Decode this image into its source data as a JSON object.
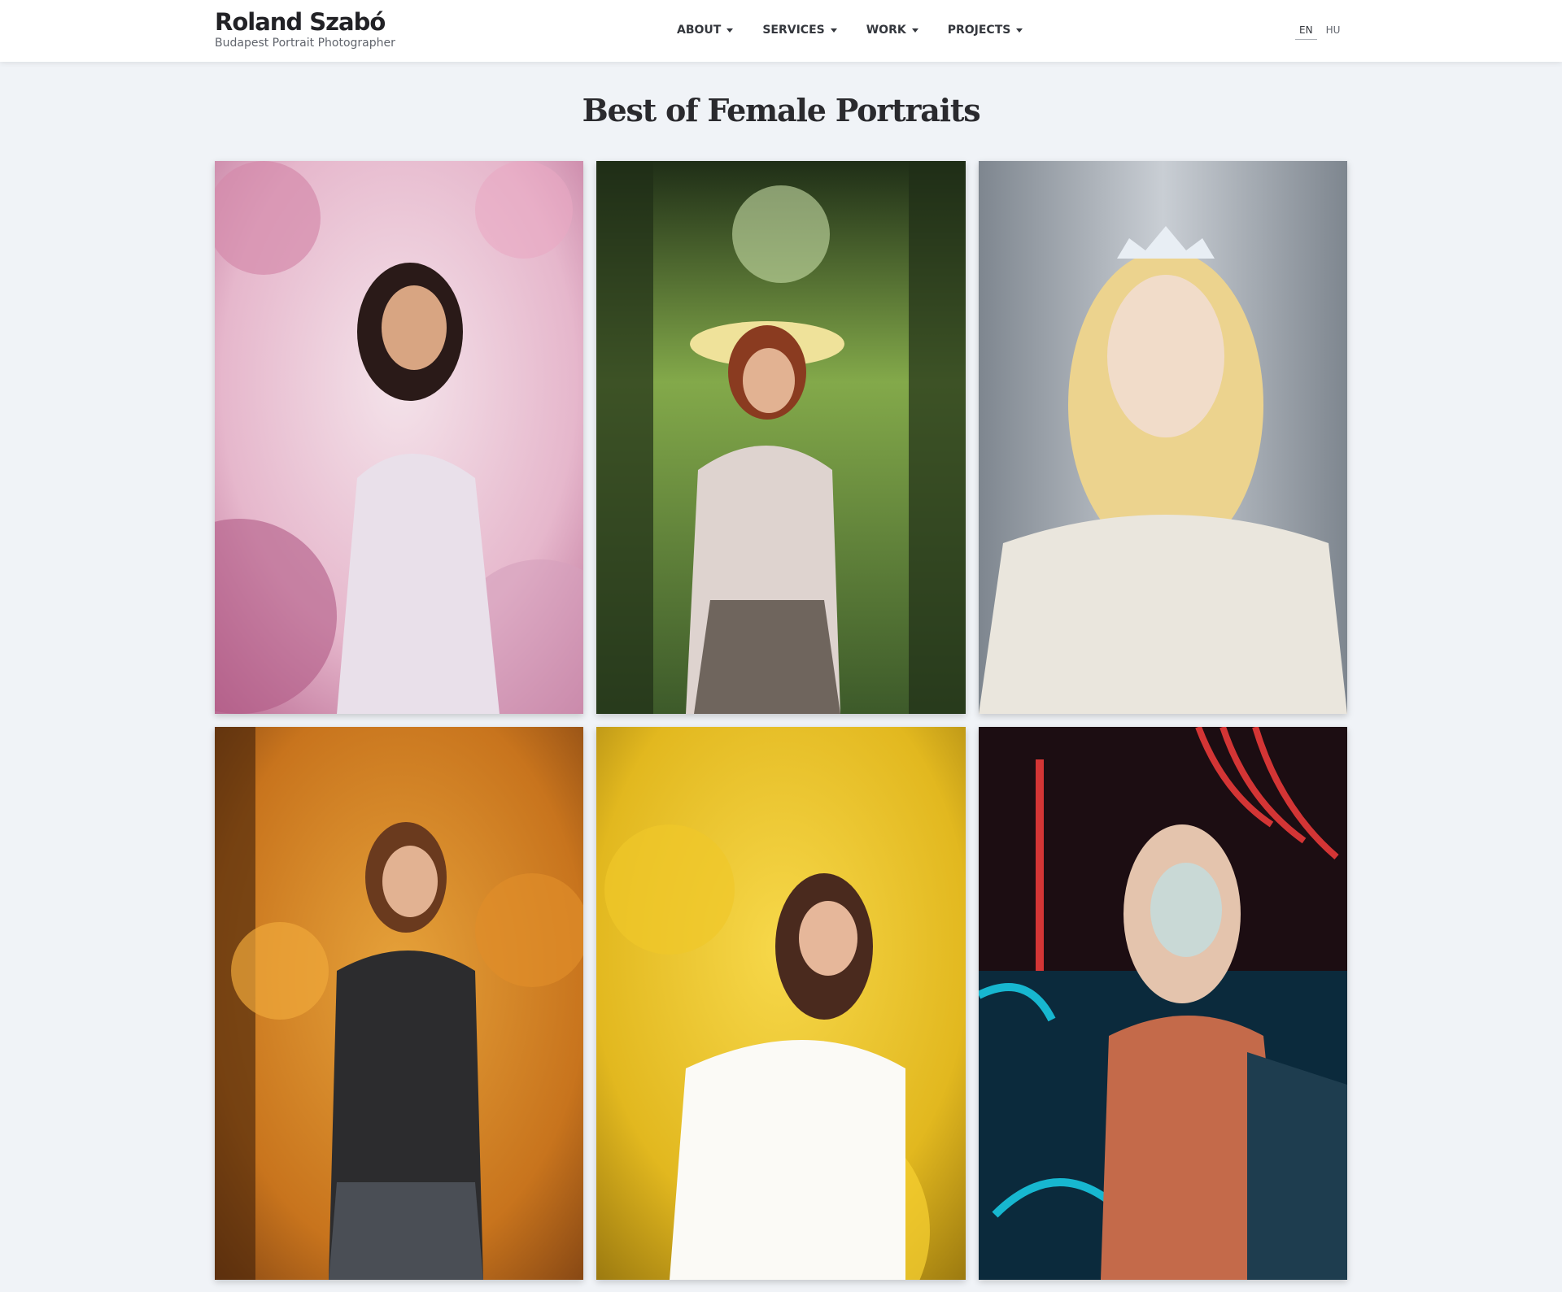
{
  "header": {
    "brand_name": "Roland Szabó",
    "tagline": "Budapest Portrait Photographer",
    "nav": [
      {
        "label": "ABOUT",
        "icon": "chevron-down-icon"
      },
      {
        "label": "SERVICES",
        "icon": "chevron-down-icon"
      },
      {
        "label": "WORK",
        "icon": "chevron-down-icon"
      },
      {
        "label": "PROJECTS",
        "icon": "chevron-down-icon"
      }
    ],
    "languages": [
      {
        "label": "EN",
        "active": true
      },
      {
        "label": "HU",
        "active": false
      }
    ]
  },
  "main": {
    "title": "Best of Female Portraits",
    "gallery": [
      {
        "scene": "magnolia-blossoms",
        "colors": [
          "#e6b7cc",
          "#b7668f",
          "#f4e3ea"
        ]
      },
      {
        "scene": "green-forest-path",
        "colors": [
          "#3d5a2a",
          "#83a94a",
          "#1f2e17"
        ]
      },
      {
        "scene": "winter-tiara",
        "colors": [
          "#c9ced4",
          "#eae6dd",
          "#7e868f"
        ]
      },
      {
        "scene": "autumn-foliage",
        "colors": [
          "#c8741d",
          "#6a3410",
          "#e6a23a"
        ]
      },
      {
        "scene": "yellow-forsythia",
        "colors": [
          "#e2b81f",
          "#8a6a0c",
          "#f7d84a"
        ]
      },
      {
        "scene": "neon-lights",
        "colors": [
          "#0b2a3c",
          "#18c7e0",
          "#e83a3a"
        ]
      }
    ]
  }
}
